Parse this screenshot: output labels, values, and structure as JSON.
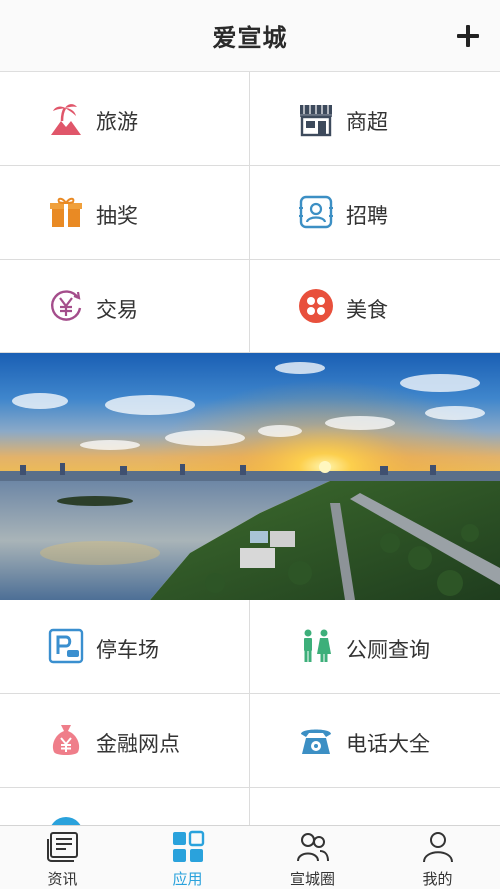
{
  "header": {
    "title": "爱宣城",
    "add_icon": "plus-icon"
  },
  "grid_top": [
    {
      "label": "旅游",
      "icon": "beach-palm-icon",
      "color": "#e0566a"
    },
    {
      "label": "商超",
      "icon": "storefront-icon",
      "color": "#3d4a5c"
    },
    {
      "label": "抽奖",
      "icon": "gift-icon",
      "color": "#e98a24"
    },
    {
      "label": "招聘",
      "icon": "id-badge-icon",
      "color": "#3c8fc4"
    },
    {
      "label": "交易",
      "icon": "yen-exchange-icon",
      "color": "#a44d8b"
    },
    {
      "label": "美食",
      "icon": "food-dots-icon",
      "color": "#e8503c"
    }
  ],
  "grid_bottom": [
    {
      "label": "停车场",
      "icon": "parking-icon",
      "color": "#3a8fcf"
    },
    {
      "label": "公厕查询",
      "icon": "restroom-icon",
      "color": "#3daf7a"
    },
    {
      "label": "金融网点",
      "icon": "money-bag-icon",
      "color": "#ef7e8a"
    },
    {
      "label": "电话大全",
      "icon": "telephone-icon",
      "color": "#3c8fc4"
    }
  ],
  "banner": {
    "icon": "sunset-lake-photo"
  },
  "tabbar": {
    "tabs": [
      {
        "label": "资讯",
        "icon": "news-icon"
      },
      {
        "label": "应用",
        "icon": "apps-grid-icon"
      },
      {
        "label": "宣城圈",
        "icon": "people-icon"
      },
      {
        "label": "我的",
        "icon": "user-icon"
      }
    ],
    "active_index": 1,
    "active_color": "#2aa2dc"
  }
}
